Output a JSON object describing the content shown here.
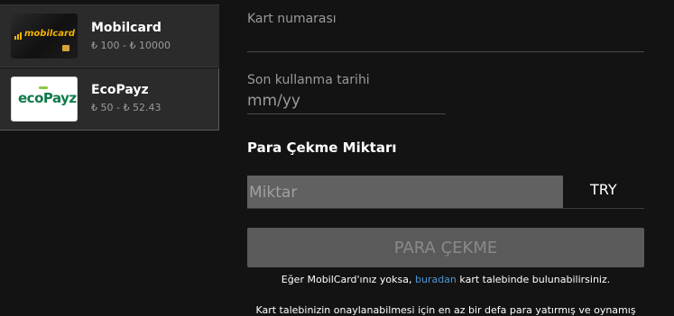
{
  "sidebar": {
    "methods": [
      {
        "logo_text": "mobilcard",
        "name": "Mobilcard",
        "range": "₺ 100 - ₺ 10000"
      },
      {
        "logo_text": "ecoPayz",
        "name": "EcoPayz",
        "range": "₺ 50 - ₺ 52.43"
      }
    ]
  },
  "form": {
    "card_number_label": "Kart numarası",
    "expiry_label": "Son kullanma tarihi",
    "expiry_placeholder": "mm/yy",
    "amount_title": "Para Çekme Miktarı",
    "amount_placeholder": "Miktar",
    "currency": "TRY",
    "withdraw_button": "PARA ÇEKME"
  },
  "notes": {
    "line1_before": "Eğer MobilCard'ınız yoksa, ",
    "line1_link": "buradan",
    "line1_after": " kart talebinde bulunabilirsiniz.",
    "line2": "Kart talebinizin onaylanabilmesi için en az bir defa para yatırmış ve oynamış"
  },
  "colors": {
    "background": "#131313",
    "panel": "#2b2b2b",
    "link": "#4d95d6",
    "mobilcard_accent": "#f3b400",
    "ecopayz_green": "#0e7a4a"
  }
}
